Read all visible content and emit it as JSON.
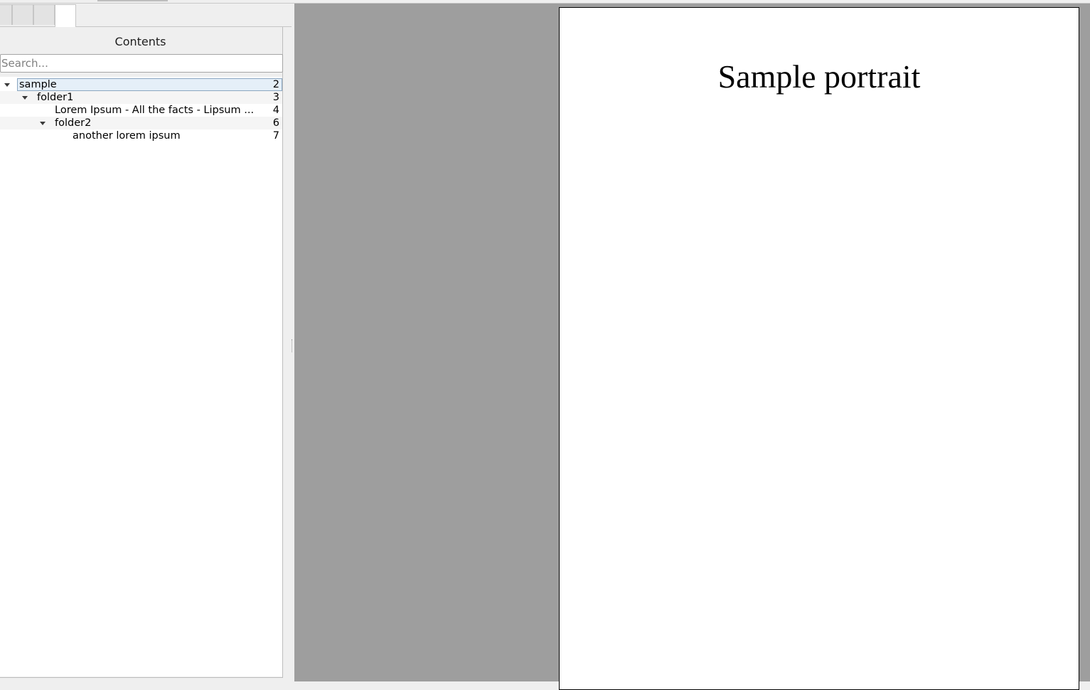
{
  "sidebar": {
    "tabs": [
      {
        "name": "tab-1"
      },
      {
        "name": "tab-2"
      },
      {
        "name": "tab-3"
      },
      {
        "name": "tab-4",
        "active": true
      }
    ],
    "contents_title": "Contents",
    "search": {
      "placeholder": "Search...",
      "value": ""
    },
    "tree": {
      "items": [
        {
          "label": "sample",
          "page": "2",
          "level": 0,
          "expanded": true,
          "selected": true
        },
        {
          "label": "folder1",
          "page": "3",
          "level": 1,
          "expanded": true
        },
        {
          "label": "Lorem Ipsum - All the facts - Lipsum ...",
          "page": "4",
          "level": 2
        },
        {
          "label": "folder2",
          "page": "6",
          "level": 2,
          "expanded": true
        },
        {
          "label": "another lorem ipsum",
          "page": "7",
          "level": 3
        }
      ]
    }
  },
  "document": {
    "title": "Sample portrait"
  },
  "colors": {
    "viewer_background": "#9e9e9e",
    "selection_fill": "#e5eff8",
    "selection_border": "#8aa6c1"
  }
}
